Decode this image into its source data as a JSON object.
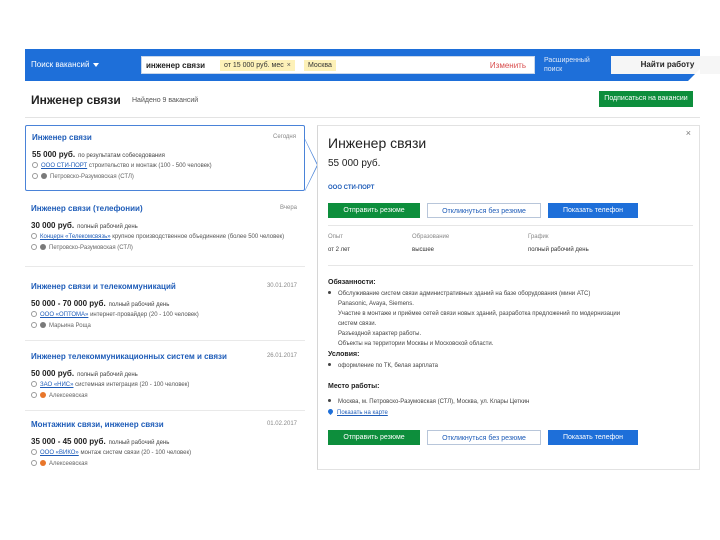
{
  "topbar": {
    "search_label": "Поиск вакансий",
    "query": "инженер связи",
    "chip_salary": "от 15 000 руб. мес",
    "chip_city": "Москва",
    "edit_label": "Изменить",
    "advanced_label": "Расширенный поиск",
    "find_button": "Найти работу"
  },
  "header": {
    "title": "Инженер связи",
    "found": "Найдено 9 вакансий",
    "subscribe_button": "Подписаться на вакансии"
  },
  "vacancies": [
    {
      "title": "Инженер связи",
      "date": "Сегодня",
      "salary": "55 000 руб.",
      "salary_note": "по результатам собеседования",
      "company": "ООО СТИ-ПОРТ",
      "company_note": "строительство и монтаж (100 - 500 человек)",
      "metro": "Петровско-Разумовская (СТЛ)",
      "metro_color": "#7a7a7a"
    },
    {
      "title": "Инженер связи (телефонии)",
      "date": "Вчера",
      "salary": "30 000 руб.",
      "salary_note": "полный рабочий день",
      "company": "Концерн «Телекомсвязь»",
      "company_note": "крупное производственное объединение (более 500 человек)",
      "metro": "Петровско-Разумовская (СТЛ)",
      "metro_color": "#7a7a7a"
    },
    {
      "title": "Инженер связи и телекоммуникаций",
      "date": "30.01.2017",
      "salary": "50 000 - 70 000 руб.",
      "salary_note": "полный рабочий день",
      "company": "ООО «ОПТОМА»",
      "company_note": "интернет-провайдер (20 - 100 человек)",
      "metro": "Марьина Роща",
      "metro_color": "#7a7a7a"
    },
    {
      "title": "Инженер телекоммуникационных систем и связи",
      "date": "26.01.2017",
      "salary": "50 000 руб.",
      "salary_note": "полный рабочий день",
      "company": "ЗАО «НИС»",
      "company_note": "системная интеграция (20 - 100 человек)",
      "metro": "Алексеевская",
      "metro_color": "#e8762a"
    },
    {
      "title": "Монтажник связи, инженер связи",
      "date": "01.02.2017",
      "salary": "35 000 - 45 000 руб.",
      "salary_note": "полный рабочий день",
      "company": "ООО «ВИКО»",
      "company_note": "монтаж систем связи (20 - 100 человек)",
      "metro": "Алексеевская",
      "metro_color": "#e8762a"
    }
  ],
  "detail": {
    "title": "Инженер связи",
    "salary": "55 000 руб.",
    "company": "ООО СТИ-ПОРТ",
    "btn_respond": "Отправить резюме",
    "btn_respond_no_resume": "Откликнуться без резюме",
    "btn_phone": "Показать телефон",
    "col_experience_h": "Опыт",
    "col_experience_v": "от 2 лет",
    "col_education_h": "Образование",
    "col_education_v": "высшее",
    "col_schedule_h": "График",
    "col_schedule_v": "полный рабочий день",
    "duties_h": "Обязанности:",
    "duty_1": "Обслуживание систем связи административных зданий на базе оборудования (мини АТС)",
    "duty_1b": "Panasonic, Avaya, Siemens.",
    "duty_1c": "Участие в монтаже и приёмке сетей связи новых зданий, разработка предложений по модернизации",
    "duty_1d": "систем связи.",
    "duty_1e": "Разъездной характер работы.",
    "duty_1f": "Объекты на территории Москвы и Московской области.",
    "conditions_h": "Условия:",
    "condition_1": "оформление по ТК, белая зарплата",
    "workplace_h": "Место работы:",
    "workplace_1": "Москва, м. Петровско-Разумовская (СТЛ), Москва, ул. Клары Цеткин",
    "show_map": "Показать на карте"
  }
}
